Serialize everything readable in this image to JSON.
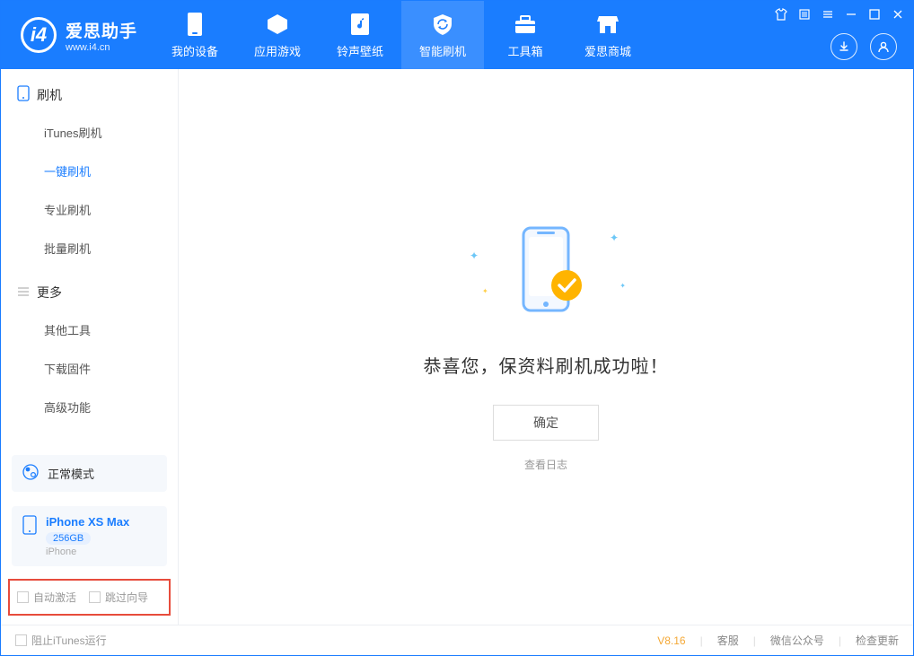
{
  "app": {
    "name": "爱思助手",
    "url": "www.i4.cn"
  },
  "nav": {
    "items": [
      {
        "label": "我的设备"
      },
      {
        "label": "应用游戏"
      },
      {
        "label": "铃声壁纸"
      },
      {
        "label": "智能刷机"
      },
      {
        "label": "工具箱"
      },
      {
        "label": "爱思商城"
      }
    ],
    "active_index": 3
  },
  "sidebar": {
    "section1": {
      "title": "刷机",
      "items": [
        "iTunes刷机",
        "一键刷机",
        "专业刷机",
        "批量刷机"
      ],
      "active_index": 1
    },
    "section2": {
      "title": "更多",
      "items": [
        "其他工具",
        "下载固件",
        "高级功能"
      ]
    }
  },
  "mode_card": {
    "label": "正常模式"
  },
  "device_card": {
    "name": "iPhone XS Max",
    "capacity": "256GB",
    "type": "iPhone"
  },
  "checkboxes": {
    "auto_activate": "自动激活",
    "skip_guide": "跳过向导"
  },
  "main": {
    "success_text": "恭喜您，保资料刷机成功啦！",
    "ok_button": "确定",
    "log_link": "查看日志"
  },
  "statusbar": {
    "block_itunes": "阻止iTunes运行",
    "version": "V8.16",
    "links": [
      "客服",
      "微信公众号",
      "检查更新"
    ]
  }
}
